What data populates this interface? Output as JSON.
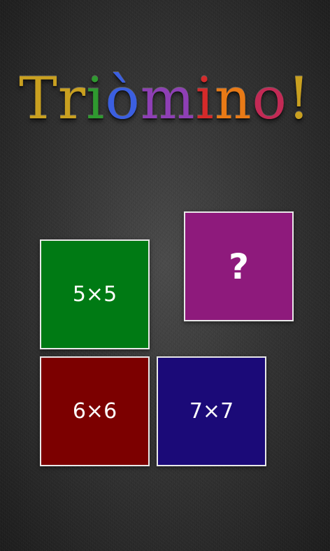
{
  "title": {
    "letters": [
      {
        "char": "T",
        "color": "#c9a020"
      },
      {
        "char": "r",
        "color": "#c9a020"
      },
      {
        "char": "i",
        "color": "#2f9a2f"
      },
      {
        "char": "ò",
        "color": "#3b5fe0"
      },
      {
        "char": "m",
        "color": "#8e3fb5"
      },
      {
        "char": "i",
        "color": "#d52a2a"
      },
      {
        "char": "n",
        "color": "#e97a16"
      },
      {
        "char": "o",
        "color": "#c22a55"
      },
      {
        "char": "!",
        "color": "#c9a020"
      }
    ]
  },
  "tiles": {
    "five": {
      "label": "5×5",
      "color": "#007a14"
    },
    "help": {
      "label": "?",
      "color": "#8e1a7c"
    },
    "six": {
      "label": "6×6",
      "color": "#7c0000"
    },
    "seven": {
      "label": "7×7",
      "color": "#1b0a78"
    }
  }
}
